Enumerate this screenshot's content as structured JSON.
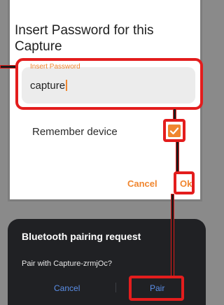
{
  "password_dialog": {
    "title": "Insert Password for this Capture",
    "field_label": "Insert Password",
    "field_value": "capture",
    "remember_label": "Remember device",
    "remember_checked": true,
    "cancel_label": "Cancel",
    "ok_label": "Ok"
  },
  "bluetooth_dialog": {
    "title": "Bluetooth pairing request",
    "message": "Pair with Capture-zrmjOc?",
    "cancel_label": "Cancel",
    "pair_label": "Pair"
  },
  "colors": {
    "accent_orange": "#f0862f",
    "highlight_red": "#e31d1d",
    "bt_link_blue": "#5b8fe8",
    "bt_background": "#202124"
  },
  "icons": {
    "checkbox": "checkmark-icon"
  }
}
